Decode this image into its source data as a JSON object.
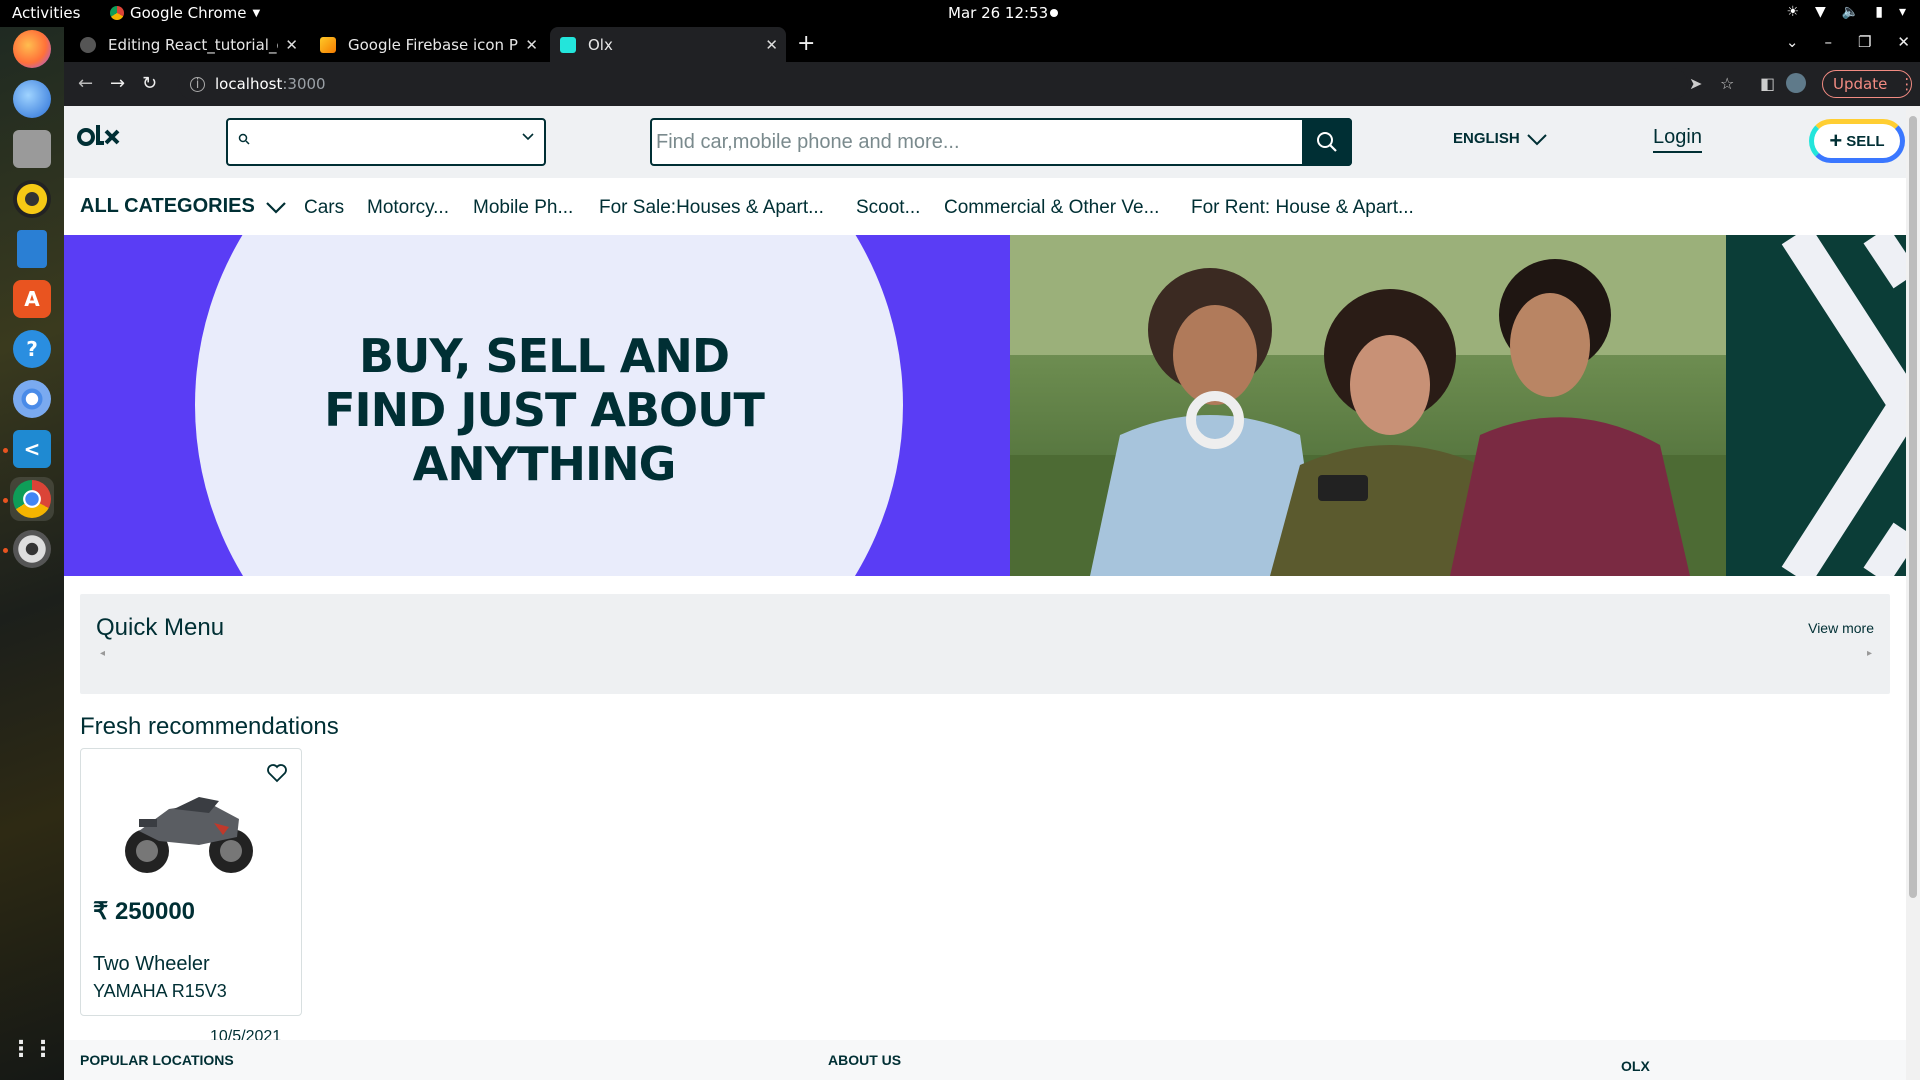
{
  "system": {
    "activities": "Activities",
    "app_name": "Google Chrome",
    "clock": "Mar 26  12:53"
  },
  "dock": {
    "icons": [
      "firefox-icon",
      "thunderbird-icon",
      "files-icon",
      "rhythmbox-icon",
      "writer-icon",
      "software-icon",
      "help-icon",
      "chromium-icon",
      "vscode-icon",
      "chrome-icon",
      "settings-icon",
      "apps-grid-icon"
    ]
  },
  "browser": {
    "tabs": [
      {
        "title": "Editing React_tutorial_olx",
        "favicon": "github-icon"
      },
      {
        "title": "Google Firebase icon PNG",
        "favicon": "firebase-icon"
      },
      {
        "title": "Olx",
        "favicon": "olx-icon",
        "active": true
      }
    ],
    "url_host": "localhost",
    "url_port": ":3000",
    "update_label": "Update"
  },
  "olx": {
    "location_placeholder": "",
    "search_placeholder": "Find car,mobile phone and more...",
    "language": "ENGLISH",
    "login_label": "Login",
    "sell_label": "SELL",
    "all_categories": "ALL CATEGORIES",
    "categories": [
      "Cars",
      "Motorcy...",
      "Mobile Ph...",
      "For Sale:Houses & Apart...",
      "Scoot...",
      "Commercial & Other Ve...",
      "For Rent: House & Apart..."
    ],
    "banner_lines": [
      "BUY, SELL AND",
      "FIND JUST ABOUT",
      "ANYTHING"
    ],
    "quick_menu_title": "Quick Menu",
    "quick_menu_view_more": "View more",
    "fresh_title": "Fresh recommendations",
    "product": {
      "price": "₹ 250000",
      "category": "Two Wheeler",
      "name": "YAMAHA R15V3",
      "date": "10/5/2021"
    },
    "footer": {
      "popular_locations": "POPULAR LOCATIONS",
      "about_us": "ABOUT US",
      "olx": "OLX"
    }
  }
}
